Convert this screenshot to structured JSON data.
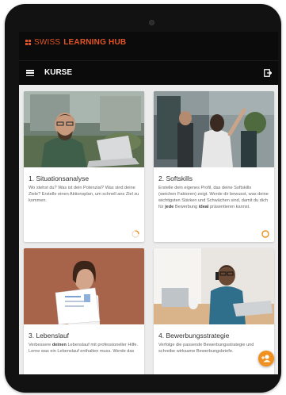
{
  "brand": {
    "prefix": "SWISS ",
    "name": "LEARNING HUB",
    "color": "#e45424"
  },
  "navbar": {
    "menu_icon": "hamburger-icon",
    "title": "KURSE",
    "exit_icon": "exit-icon"
  },
  "cards": [
    {
      "title": "1. Situationsanalyse",
      "text": "Wo stehst du? Was ist dein Potenzial? Was sind deine Ziele? Erstelle einen Aktionsplan, um schnell ans Ziel zu kommen.",
      "progress_icon": "progress-ring-icon"
    },
    {
      "title": "2. Softskills",
      "text_parts": [
        "Erstelle dein eigenes Profil, das deine Softskills (weichen Faktoren) zeigt. Werde dir bewusst, was deine wichtigsten Stärken und Schwächen sind, damit du dich für ",
        "jede",
        " Bewerbung ",
        "ideal",
        " präsentieren kannst."
      ],
      "progress_icon": "progress-ring-icon"
    },
    {
      "title": "3. Lebenslauf",
      "text_parts": [
        "Verbessere ",
        "deinen",
        " Lebenslauf mit professioneller Hilfe. Lerne was ein Lebenslauf enthalten muss. Werde das"
      ]
    },
    {
      "title": "4. Bewerbungsstrategie",
      "text": "Verfolge die passende Bewerbungsstrategie und schreibe wirksame Bewerbungsbriefe."
    }
  ],
  "fab": {
    "icon": "add-user-icon",
    "color": "#f0901e"
  }
}
